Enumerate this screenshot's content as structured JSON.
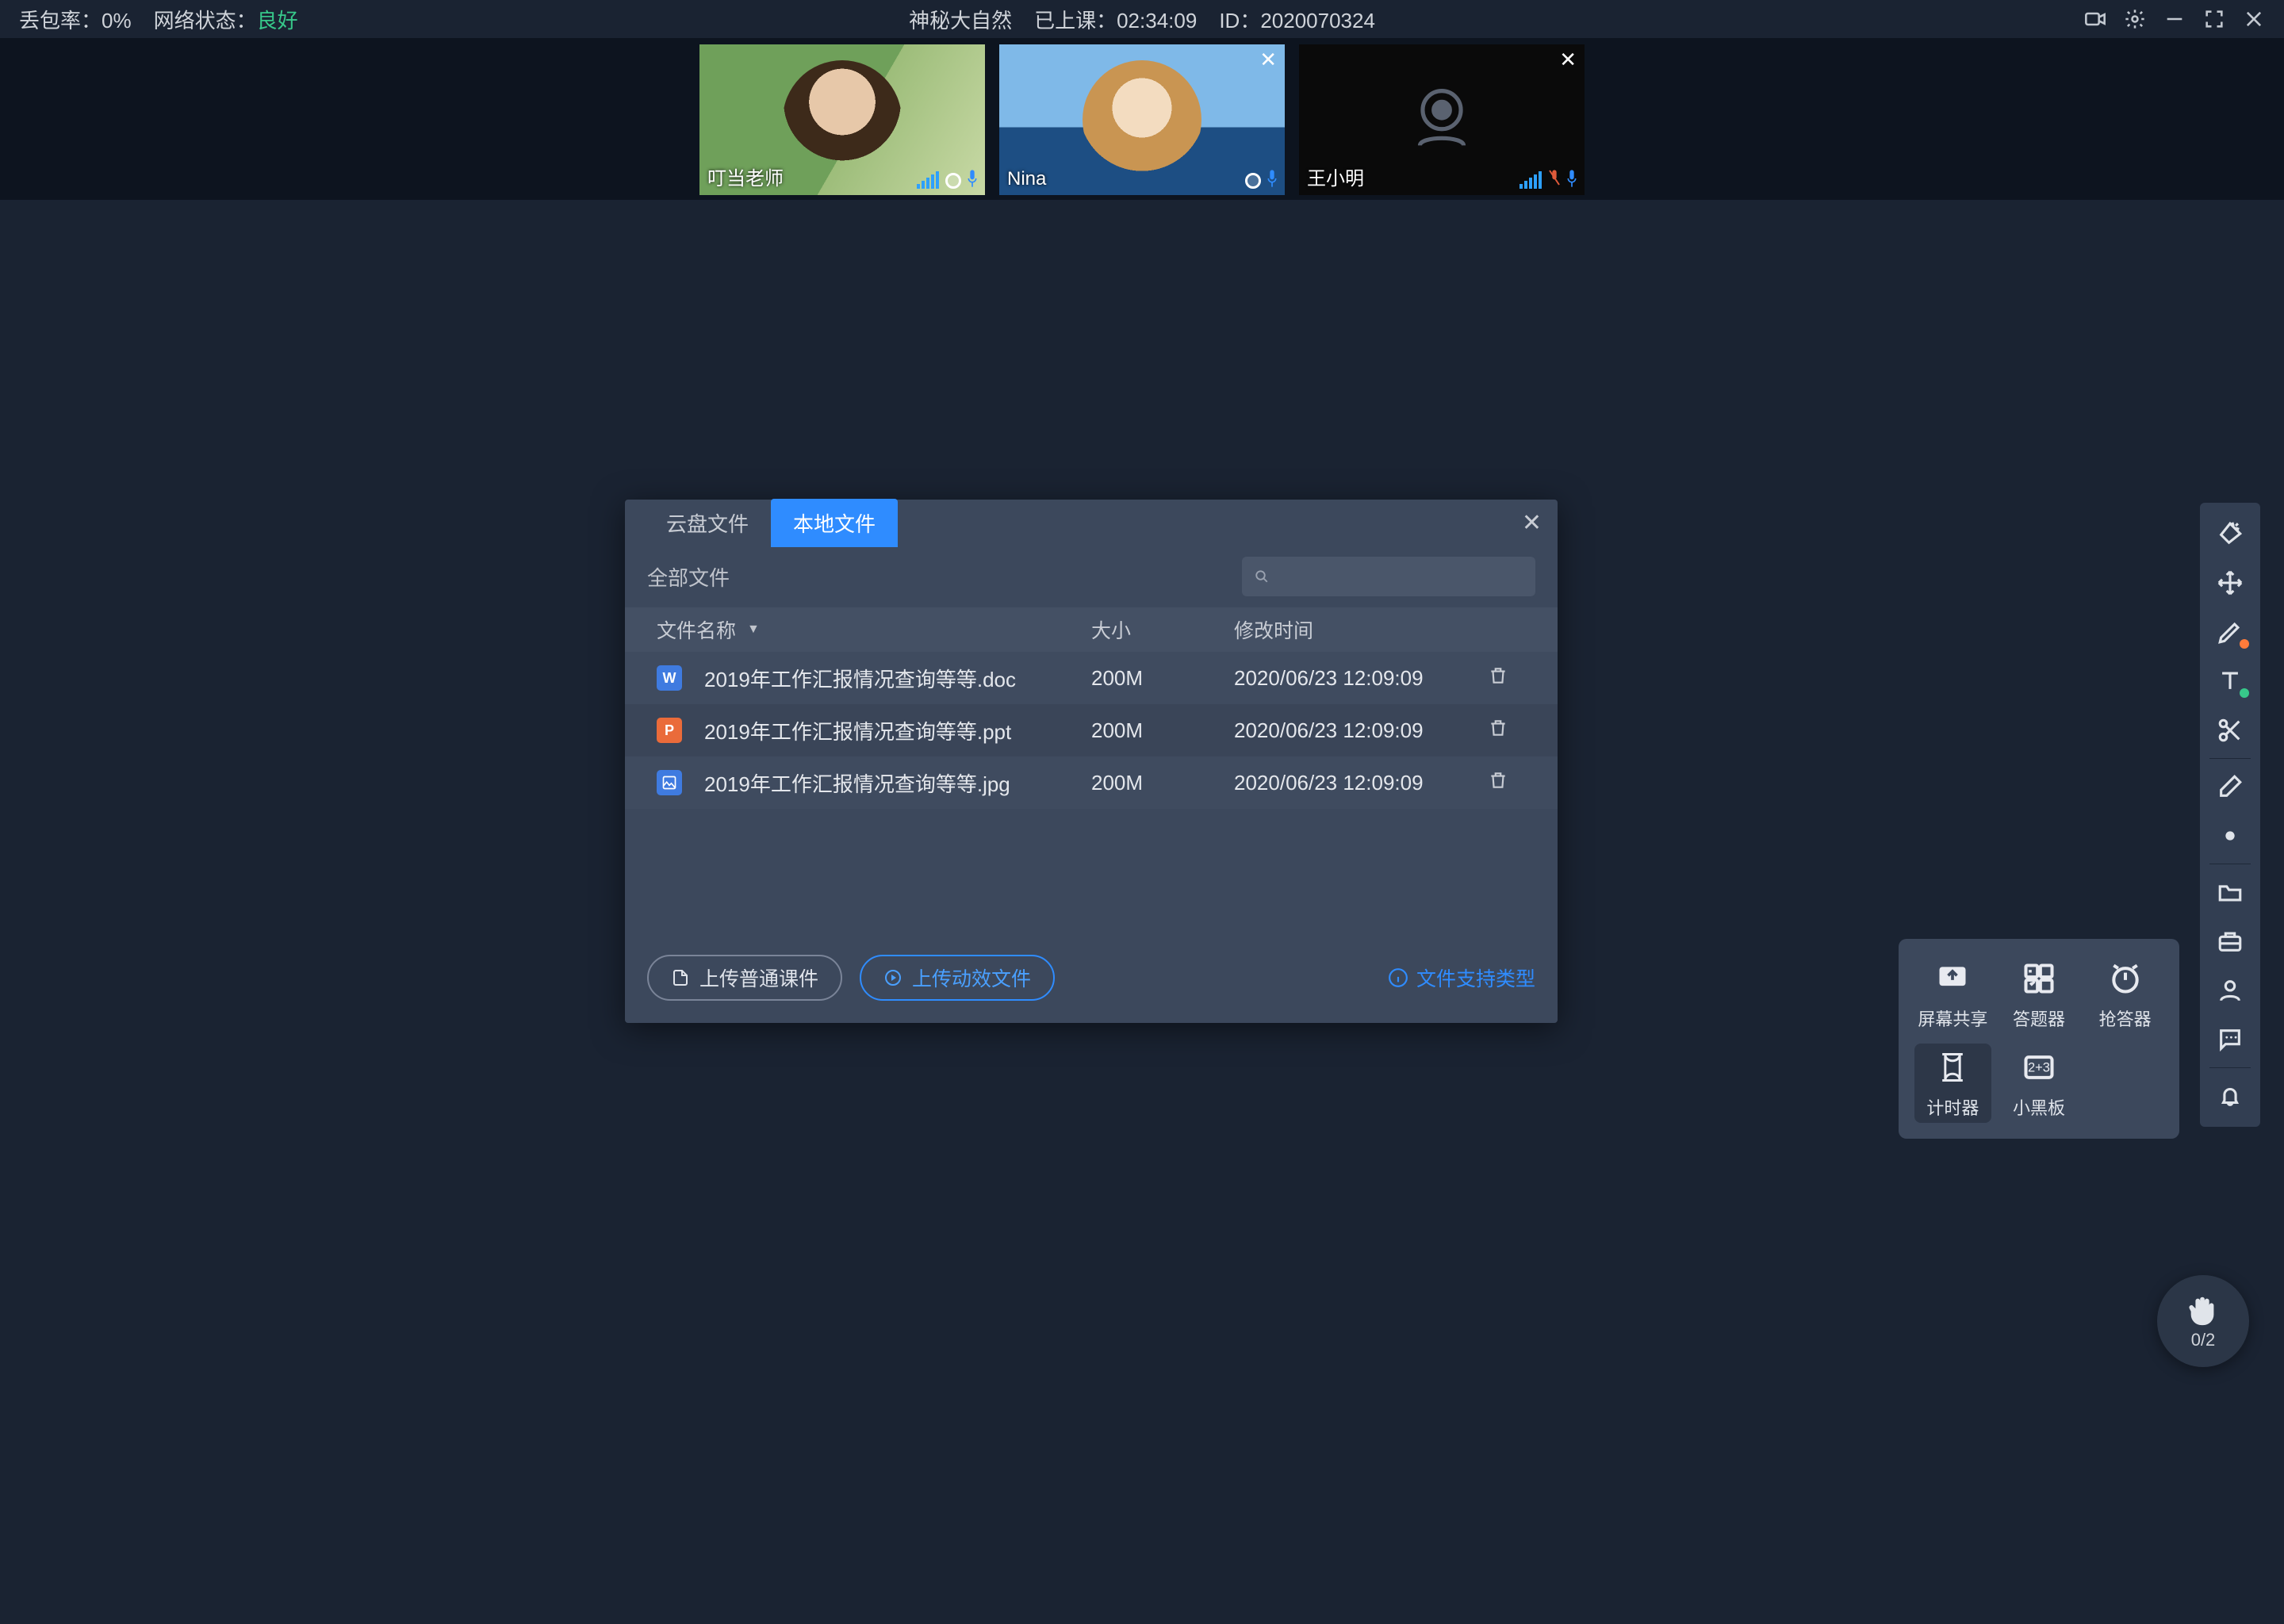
{
  "status": {
    "packet_loss_label": "丢包率：",
    "packet_loss_value": "0%",
    "network_label": "网络状态：",
    "network_value": "良好",
    "title": "神秘大自然",
    "elapsed_label": "已上课：",
    "elapsed_value": "02:34:09",
    "id_label": "ID：",
    "id_value": "2020070324"
  },
  "participants": [
    {
      "name": "叮当老师",
      "has_close": false,
      "mic_color": "#2f8cff",
      "mic_muted": false,
      "cam_on": true
    },
    {
      "name": "Nina",
      "has_close": true,
      "mic_color": "#2f8cff",
      "mic_muted": false,
      "cam_on": true
    },
    {
      "name": "王小明",
      "has_close": true,
      "mic_color": "#2f8cff",
      "mic_muted": true,
      "cam_on": false
    }
  ],
  "dialog": {
    "tabs": {
      "cloud": "云盘文件",
      "local": "本地文件"
    },
    "all_files": "全部文件",
    "search_placeholder": "",
    "columns": {
      "name": "文件名称",
      "size": "大小",
      "time": "修改时间"
    },
    "files": [
      {
        "icon": "doc",
        "badge": "W",
        "name": "2019年工作汇报情况查询等等.doc",
        "size": "200M",
        "time": "2020/06/23 12:09:09"
      },
      {
        "icon": "ppt",
        "badge": "P",
        "name": "2019年工作汇报情况查询等等.ppt",
        "size": "200M",
        "time": "2020/06/23 12:09:09"
      },
      {
        "icon": "img",
        "badge": "▲",
        "name": "2019年工作汇报情况查询等等.jpg",
        "size": "200M",
        "time": "2020/06/23 12:09:09"
      }
    ],
    "upload_normal": "上传普通课件",
    "upload_dynamic": "上传动效文件",
    "support_link": "文件支持类型"
  },
  "popover": {
    "screen_share": "屏幕共享",
    "answer_tool": "答题器",
    "buzzer": "抢答器",
    "timer": "计时器",
    "mini_board": "小黑板"
  },
  "hand": {
    "count": "0/2"
  }
}
